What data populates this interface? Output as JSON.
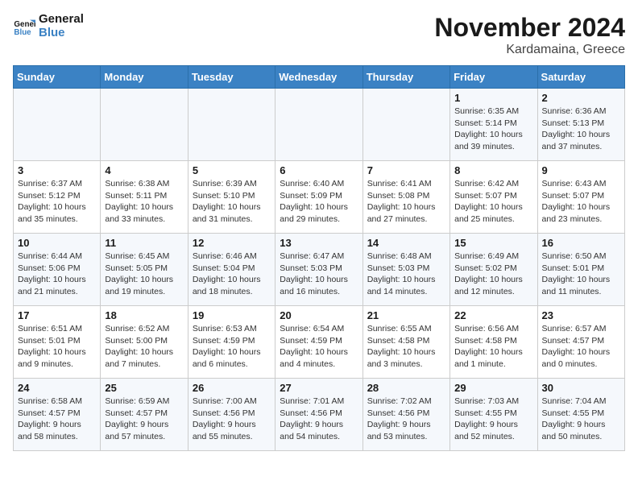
{
  "logo": {
    "line1": "General",
    "line2": "Blue"
  },
  "title": "November 2024",
  "location": "Kardamaina, Greece",
  "headers": [
    "Sunday",
    "Monday",
    "Tuesday",
    "Wednesday",
    "Thursday",
    "Friday",
    "Saturday"
  ],
  "weeks": [
    [
      {
        "day": "",
        "info": ""
      },
      {
        "day": "",
        "info": ""
      },
      {
        "day": "",
        "info": ""
      },
      {
        "day": "",
        "info": ""
      },
      {
        "day": "",
        "info": ""
      },
      {
        "day": "1",
        "info": "Sunrise: 6:35 AM\nSunset: 5:14 PM\nDaylight: 10 hours and 39 minutes."
      },
      {
        "day": "2",
        "info": "Sunrise: 6:36 AM\nSunset: 5:13 PM\nDaylight: 10 hours and 37 minutes."
      }
    ],
    [
      {
        "day": "3",
        "info": "Sunrise: 6:37 AM\nSunset: 5:12 PM\nDaylight: 10 hours and 35 minutes."
      },
      {
        "day": "4",
        "info": "Sunrise: 6:38 AM\nSunset: 5:11 PM\nDaylight: 10 hours and 33 minutes."
      },
      {
        "day": "5",
        "info": "Sunrise: 6:39 AM\nSunset: 5:10 PM\nDaylight: 10 hours and 31 minutes."
      },
      {
        "day": "6",
        "info": "Sunrise: 6:40 AM\nSunset: 5:09 PM\nDaylight: 10 hours and 29 minutes."
      },
      {
        "day": "7",
        "info": "Sunrise: 6:41 AM\nSunset: 5:08 PM\nDaylight: 10 hours and 27 minutes."
      },
      {
        "day": "8",
        "info": "Sunrise: 6:42 AM\nSunset: 5:07 PM\nDaylight: 10 hours and 25 minutes."
      },
      {
        "day": "9",
        "info": "Sunrise: 6:43 AM\nSunset: 5:07 PM\nDaylight: 10 hours and 23 minutes."
      }
    ],
    [
      {
        "day": "10",
        "info": "Sunrise: 6:44 AM\nSunset: 5:06 PM\nDaylight: 10 hours and 21 minutes."
      },
      {
        "day": "11",
        "info": "Sunrise: 6:45 AM\nSunset: 5:05 PM\nDaylight: 10 hours and 19 minutes."
      },
      {
        "day": "12",
        "info": "Sunrise: 6:46 AM\nSunset: 5:04 PM\nDaylight: 10 hours and 18 minutes."
      },
      {
        "day": "13",
        "info": "Sunrise: 6:47 AM\nSunset: 5:03 PM\nDaylight: 10 hours and 16 minutes."
      },
      {
        "day": "14",
        "info": "Sunrise: 6:48 AM\nSunset: 5:03 PM\nDaylight: 10 hours and 14 minutes."
      },
      {
        "day": "15",
        "info": "Sunrise: 6:49 AM\nSunset: 5:02 PM\nDaylight: 10 hours and 12 minutes."
      },
      {
        "day": "16",
        "info": "Sunrise: 6:50 AM\nSunset: 5:01 PM\nDaylight: 10 hours and 11 minutes."
      }
    ],
    [
      {
        "day": "17",
        "info": "Sunrise: 6:51 AM\nSunset: 5:01 PM\nDaylight: 10 hours and 9 minutes."
      },
      {
        "day": "18",
        "info": "Sunrise: 6:52 AM\nSunset: 5:00 PM\nDaylight: 10 hours and 7 minutes."
      },
      {
        "day": "19",
        "info": "Sunrise: 6:53 AM\nSunset: 4:59 PM\nDaylight: 10 hours and 6 minutes."
      },
      {
        "day": "20",
        "info": "Sunrise: 6:54 AM\nSunset: 4:59 PM\nDaylight: 10 hours and 4 minutes."
      },
      {
        "day": "21",
        "info": "Sunrise: 6:55 AM\nSunset: 4:58 PM\nDaylight: 10 hours and 3 minutes."
      },
      {
        "day": "22",
        "info": "Sunrise: 6:56 AM\nSunset: 4:58 PM\nDaylight: 10 hours and 1 minute."
      },
      {
        "day": "23",
        "info": "Sunrise: 6:57 AM\nSunset: 4:57 PM\nDaylight: 10 hours and 0 minutes."
      }
    ],
    [
      {
        "day": "24",
        "info": "Sunrise: 6:58 AM\nSunset: 4:57 PM\nDaylight: 9 hours and 58 minutes."
      },
      {
        "day": "25",
        "info": "Sunrise: 6:59 AM\nSunset: 4:57 PM\nDaylight: 9 hours and 57 minutes."
      },
      {
        "day": "26",
        "info": "Sunrise: 7:00 AM\nSunset: 4:56 PM\nDaylight: 9 hours and 55 minutes."
      },
      {
        "day": "27",
        "info": "Sunrise: 7:01 AM\nSunset: 4:56 PM\nDaylight: 9 hours and 54 minutes."
      },
      {
        "day": "28",
        "info": "Sunrise: 7:02 AM\nSunset: 4:56 PM\nDaylight: 9 hours and 53 minutes."
      },
      {
        "day": "29",
        "info": "Sunrise: 7:03 AM\nSunset: 4:55 PM\nDaylight: 9 hours and 52 minutes."
      },
      {
        "day": "30",
        "info": "Sunrise: 7:04 AM\nSunset: 4:55 PM\nDaylight: 9 hours and 50 minutes."
      }
    ]
  ]
}
